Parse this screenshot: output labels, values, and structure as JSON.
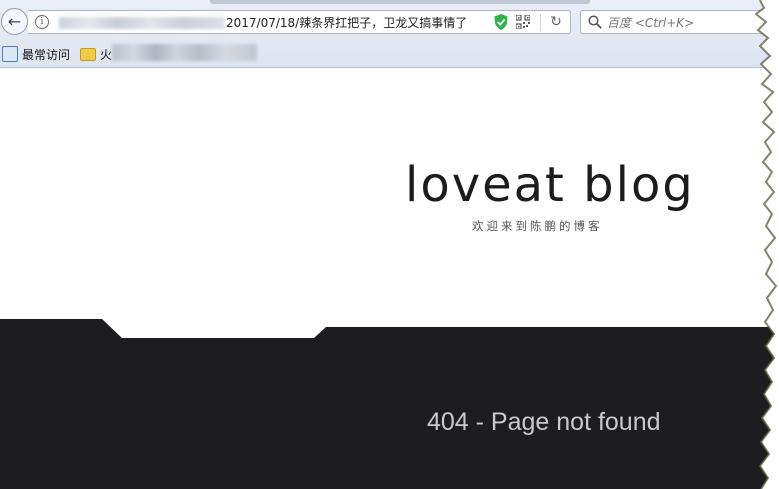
{
  "browser": {
    "url_path": "2017/07/18/辣条界扛把子，卫龙又搞事情了",
    "search_placeholder": "百度 <Ctrl+K>",
    "bookmarks": [
      {
        "label": "最常访问"
      },
      {
        "label": "火"
      }
    ]
  },
  "page": {
    "logo": "loveat blog",
    "tagline": "欢迎来到陈鹏的博客",
    "error_message": "404 - Page not found"
  },
  "colors": {
    "dark_band": "#1d1d20",
    "text_light": "#c9cacd"
  }
}
